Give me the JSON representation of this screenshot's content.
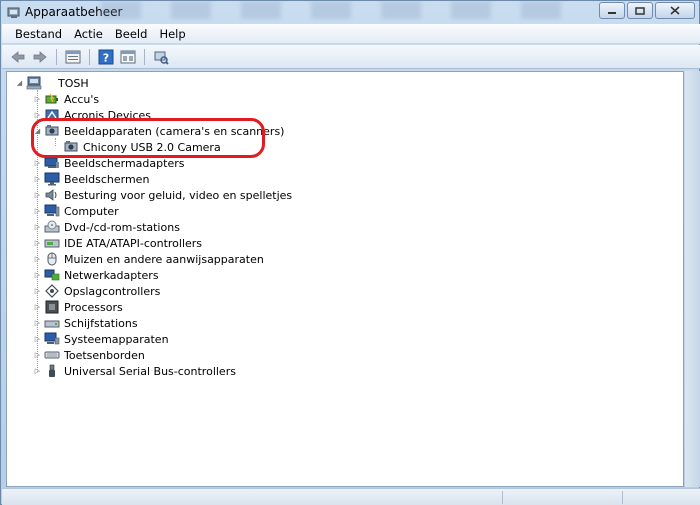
{
  "window": {
    "title": "Apparaatbeheer",
    "icon": "device-manager-icon"
  },
  "menu": [
    "Bestand",
    "Actie",
    "Beeld",
    "Help"
  ],
  "toolbar": {
    "icons": [
      "back-arrow-icon",
      "forward-arrow-icon",
      "properties-icon",
      "help-icon",
      "view-icon",
      "scan-hardware-icon"
    ]
  },
  "tree": {
    "root": "TOSH",
    "categories": [
      {
        "label": "Accu's",
        "icon": "battery-icon",
        "expanded": false
      },
      {
        "label": "Acronis Devices",
        "icon": "acronis-icon",
        "expanded": false
      },
      {
        "label": "Beeldapparaten (camera's en scanners)",
        "icon": "camera-icon",
        "expanded": true,
        "children": [
          "Chicony USB 2.0 Camera"
        ]
      },
      {
        "label": "Beeldschermadapters",
        "icon": "display-adapter-icon",
        "expanded": false
      },
      {
        "label": "Beeldschermen",
        "icon": "monitor-icon",
        "expanded": false
      },
      {
        "label": "Besturing voor geluid, video en spelletjes",
        "icon": "sound-icon",
        "expanded": false
      },
      {
        "label": "Computer",
        "icon": "computer-icon",
        "expanded": false
      },
      {
        "label": "Dvd-/cd-rom-stations",
        "icon": "dvd-drive-icon",
        "expanded": false
      },
      {
        "label": "IDE ATA/ATAPI-controllers",
        "icon": "ide-controller-icon",
        "expanded": false
      },
      {
        "label": "Muizen en andere aanwijsapparaten",
        "icon": "mouse-icon",
        "expanded": false
      },
      {
        "label": "Netwerkadapters",
        "icon": "network-adapter-icon",
        "expanded": false
      },
      {
        "label": "Opslagcontrollers",
        "icon": "storage-controller-icon",
        "expanded": false
      },
      {
        "label": "Processors",
        "icon": "processor-icon",
        "expanded": false
      },
      {
        "label": "Schijfstations",
        "icon": "disk-drive-icon",
        "expanded": false
      },
      {
        "label": "Systeemapparaten",
        "icon": "system-device-icon",
        "expanded": false
      },
      {
        "label": "Toetsenborden",
        "icon": "keyboard-icon",
        "expanded": false
      },
      {
        "label": "Universal Serial Bus-controllers",
        "icon": "usb-icon",
        "expanded": false
      }
    ]
  },
  "colors": {
    "highlight": "#e11b22"
  }
}
